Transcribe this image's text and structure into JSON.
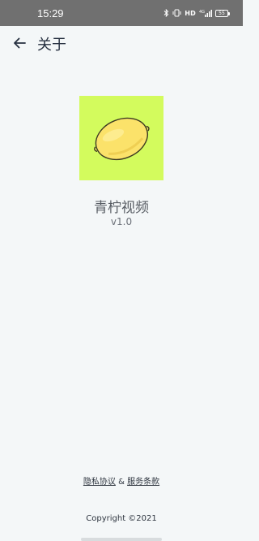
{
  "status_bar": {
    "time": "15:29",
    "network_label": "HD",
    "signal_label": "4G",
    "battery_level": "55"
  },
  "header": {
    "title": "关于",
    "back_icon": "arrow-left-icon"
  },
  "app": {
    "logo_icon": "lemon-icon",
    "logo_background": "#d3fb5d",
    "name": "青柠视频",
    "version": "v1.0"
  },
  "footer": {
    "privacy_label": "隐私协议",
    "separator": "&",
    "terms_label": "服务条款",
    "copyright": "Copyright ©2021"
  }
}
